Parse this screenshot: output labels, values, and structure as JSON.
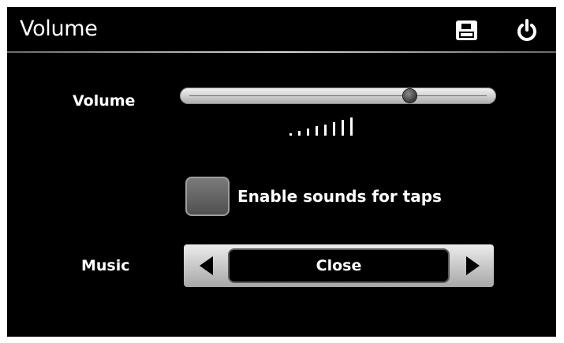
{
  "header": {
    "title": "Volume",
    "save_icon": "floppy-disk-icon",
    "power_icon": "power-icon"
  },
  "volume": {
    "label": "Volume",
    "level_fraction": 0.74,
    "indicator": {
      "total_bars": 8,
      "active_bars": 8
    }
  },
  "tap_sounds": {
    "label": "Enable sounds for taps",
    "checked": false
  },
  "music": {
    "label": "Music",
    "value": "Close",
    "prev_icon": "triangle-left-icon",
    "next_icon": "triangle-right-icon"
  },
  "colors": {
    "background": "#000000",
    "text": "#ffffff",
    "control_light": "#d2d2d2"
  }
}
